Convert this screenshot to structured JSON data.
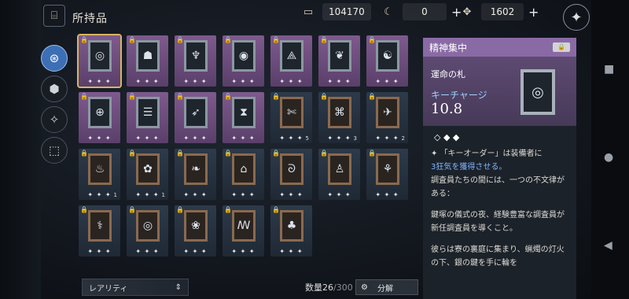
{
  "header": {
    "title": "所持品"
  },
  "resources": [
    {
      "icon": "ticket-icon",
      "value": "104170"
    },
    {
      "icon": "moon-gem-icon",
      "value": "0"
    },
    {
      "icon": "shard-icon",
      "value": "1602"
    }
  ],
  "detail": {
    "category": "精神集中",
    "name": "運命の札",
    "stat_label": "キーチャージ",
    "stat_value": "10.8",
    "effect_pre": "「キーオーダー」は装備者に",
    "effect_highlight": "3狂気を獲得させる。",
    "lore1": "調査員たちの間には、一つの不文律がある：",
    "lore2": "鍵塚の儀式の夜、経験豊富な調査員が新任調査員を導くこと。",
    "lore3": "彼らは寮の裏庭に集まり、蝋燭の灯火の下、銀の鍵を手に輪を"
  },
  "footer": {
    "rarity_label": "レアリティ",
    "count_label": "数量",
    "count": "26",
    "max": "/300",
    "decompose_label": "分解"
  },
  "cards": [
    {
      "color": "purple",
      "sel": true,
      "glyph": "◎",
      "stars": "✦ ✦ ✦",
      "count": ""
    },
    {
      "color": "purple",
      "glyph": "☗",
      "stars": "✦ ✦ ✦",
      "count": ""
    },
    {
      "color": "purple",
      "glyph": "♆",
      "stars": "✦ ✦ ✦",
      "count": ""
    },
    {
      "color": "purple",
      "glyph": "◉",
      "stars": "✦ ✦ ✦",
      "count": ""
    },
    {
      "color": "purple",
      "glyph": "⟁",
      "stars": "✦ ✦ ✦",
      "count": ""
    },
    {
      "color": "purple",
      "glyph": "❦",
      "stars": "✦ ✦ ✦",
      "count": ""
    },
    {
      "color": "purple",
      "glyph": "☯",
      "stars": "✦ ✦ ✦",
      "count": ""
    },
    {
      "color": "purple",
      "glyph": "⊕",
      "stars": "✦ ✦ ✦",
      "count": ""
    },
    {
      "color": "purple",
      "glyph": "☰",
      "stars": "✦ ✦ ✦",
      "count": ""
    },
    {
      "color": "purple",
      "glyph": "➶",
      "stars": "✦ ✦ ✦",
      "count": ""
    },
    {
      "color": "purple",
      "glyph": "⧗",
      "stars": "✦ ✦ ✦",
      "count": ""
    },
    {
      "color": "blue",
      "glyph": "✄",
      "stars": "✦ ✦ ✦",
      "count": "5"
    },
    {
      "color": "blue",
      "glyph": "⌘",
      "stars": "✦ ✦ ✦",
      "count": "3"
    },
    {
      "color": "blue",
      "glyph": "✈",
      "stars": "✦ ✦ ✦",
      "count": "2"
    },
    {
      "color": "blue",
      "glyph": "♨",
      "stars": "✦ ✦ ✦",
      "count": "1"
    },
    {
      "color": "blue",
      "glyph": "✿",
      "stars": "✦ ✦ ✦",
      "count": "1"
    },
    {
      "color": "blue",
      "glyph": "❧",
      "stars": "✦ ✦ ✦",
      "count": ""
    },
    {
      "color": "blue",
      "glyph": "⌂",
      "stars": "✦ ✦ ✦",
      "count": ""
    },
    {
      "color": "blue",
      "glyph": "ᘐ",
      "stars": "✦ ✦ ✦",
      "count": ""
    },
    {
      "color": "blue",
      "glyph": "♙",
      "stars": "✦ ✦ ✦",
      "count": ""
    },
    {
      "color": "blue",
      "glyph": "⚘",
      "stars": "✦ ✦ ✦",
      "count": ""
    },
    {
      "color": "blue",
      "glyph": "⚕",
      "stars": "✦ ✦ ✦",
      "count": ""
    },
    {
      "color": "blue",
      "glyph": "◎",
      "stars": "✦ ✦ ✦",
      "count": ""
    },
    {
      "color": "blue",
      "glyph": "❀",
      "stars": "✦ ✦ ✦",
      "count": ""
    },
    {
      "color": "blue",
      "glyph": "ꟿ",
      "stars": "✦ ✦ ✦",
      "count": ""
    },
    {
      "color": "blue",
      "glyph": "♣",
      "stars": "✦ ✦ ✦",
      "count": ""
    }
  ]
}
